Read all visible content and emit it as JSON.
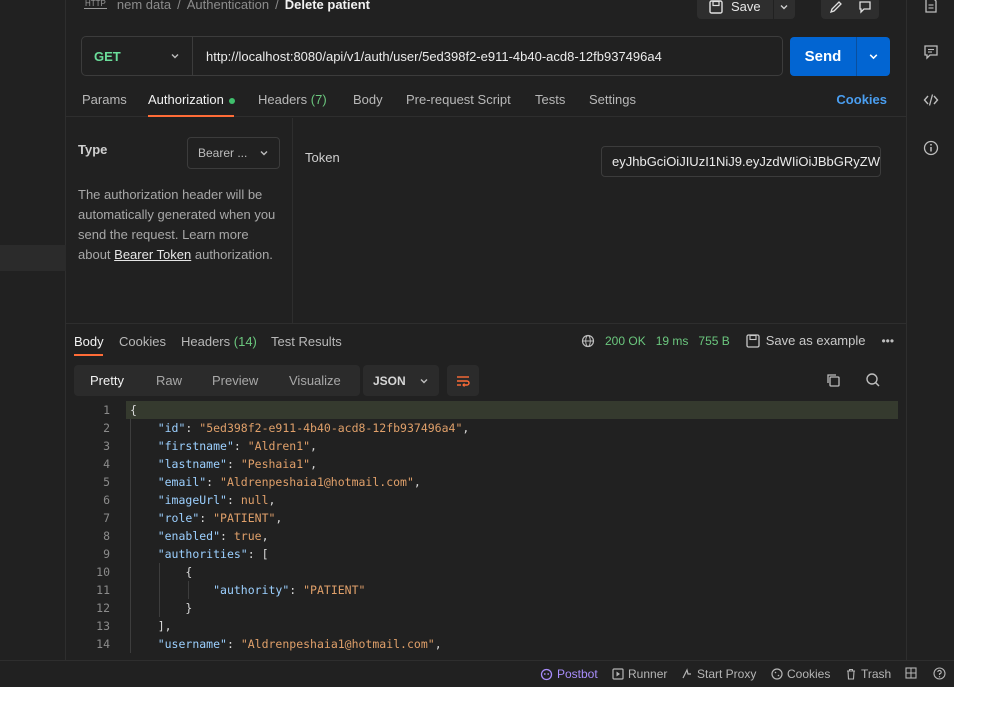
{
  "breadcrumb": {
    "http_badge": "HTTP",
    "parts": [
      "nem data",
      "Authentication"
    ],
    "current": "Delete patient"
  },
  "toolbar": {
    "save_label": "Save"
  },
  "request": {
    "method": "GET",
    "url": "http://localhost:8080/api/v1/auth/user/5ed398f2-e911-4b40-acd8-12fb937496a4",
    "send_label": "Send"
  },
  "request_tabs": {
    "params": "Params",
    "authorization": "Authorization",
    "headers": "Headers",
    "headers_count": "(7)",
    "body": "Body",
    "prerequest": "Pre-request Script",
    "tests": "Tests",
    "settings": "Settings",
    "cookies": "Cookies"
  },
  "auth": {
    "type_label": "Type",
    "type_value": "Bearer ...",
    "desc_1": "The authorization header will be automatically generated when you send the request. Learn more about ",
    "desc_link": "Bearer Token",
    "desc_2": " authorization.",
    "token_label": "Token",
    "token_value": "eyJhbGciOiJIUzI1NiJ9.eyJzdWIiOiJBbGRyZW..."
  },
  "response_tabs": {
    "body": "Body",
    "cookies": "Cookies",
    "headers": "Headers",
    "headers_count": "(14)",
    "test_results": "Test Results"
  },
  "response_meta": {
    "status": "200 OK",
    "time": "19 ms",
    "size": "755 B",
    "save_example": "Save as example"
  },
  "view_tabs": {
    "pretty": "Pretty",
    "raw": "Raw",
    "preview": "Preview",
    "visualize": "Visualize",
    "format": "JSON"
  },
  "code": {
    "line_numbers": [
      "1",
      "2",
      "3",
      "4",
      "5",
      "6",
      "7",
      "8",
      "9",
      "10",
      "11",
      "12",
      "13",
      "14"
    ],
    "id": "\"5ed398f2-e911-4b40-acd8-12fb937496a4\"",
    "firstname": "\"Aldren1\"",
    "lastname": "\"Peshaia1\"",
    "email": "\"Aldrenpeshaia1@hotmail.com\"",
    "imageUrl": "null",
    "role": "\"PATIENT\"",
    "enabled": "true",
    "authority": "\"PATIENT\"",
    "username": "\"Aldrenpeshaia1@hotmail.com\""
  },
  "statusbar": {
    "postbot": "Postbot",
    "runner": "Runner",
    "start_proxy": "Start Proxy",
    "cookies": "Cookies",
    "trash": "Trash"
  },
  "colors": {
    "accent_orange": "#ff6c37",
    "send_blue": "#0265d2",
    "method_green": "#6bdd9a",
    "status_green": "#6bc77e"
  }
}
